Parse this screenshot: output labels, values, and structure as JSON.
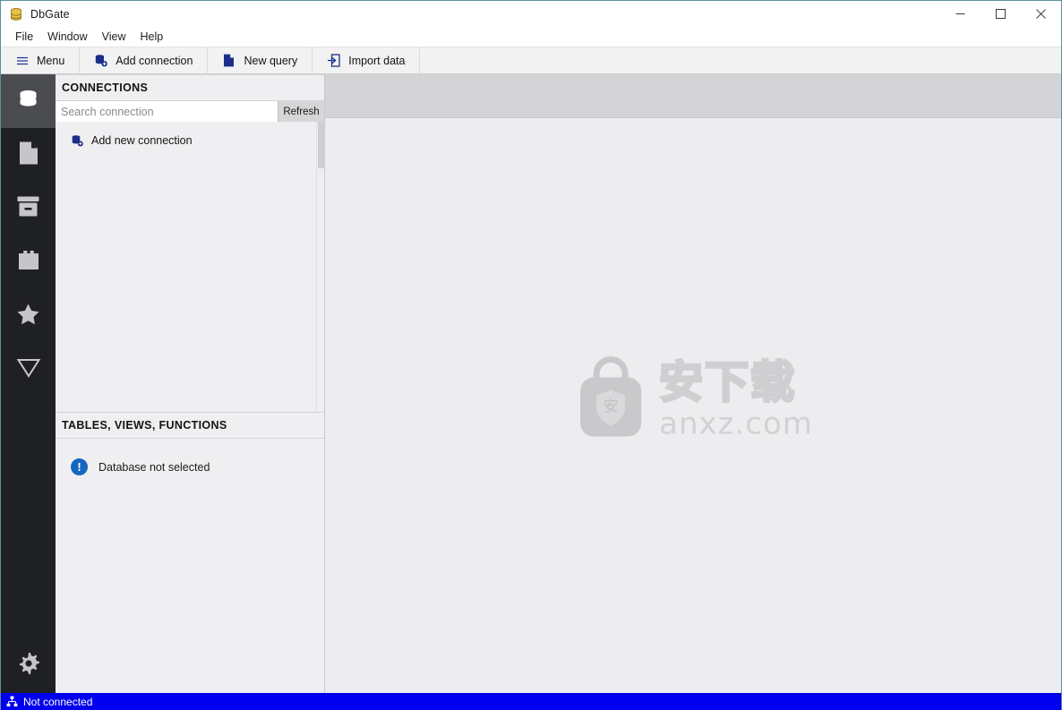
{
  "window": {
    "title": "DbGate",
    "app_icon": "database-icon",
    "controls": [
      {
        "name": "minimize-button",
        "glyph": "─"
      },
      {
        "name": "maximize-button",
        "glyph": "□"
      },
      {
        "name": "close-button",
        "glyph": "✕"
      }
    ]
  },
  "menubar": {
    "items": [
      {
        "label": "File"
      },
      {
        "label": "Window"
      },
      {
        "label": "View"
      },
      {
        "label": "Help"
      }
    ]
  },
  "toolbar": {
    "buttons": [
      {
        "label": "Menu",
        "icon": "hamburger-icon"
      },
      {
        "label": "Add connection",
        "icon": "database-plus-icon"
      },
      {
        "label": "New query",
        "icon": "file-icon"
      },
      {
        "label": "Import data",
        "icon": "import-arrow-icon"
      }
    ]
  },
  "rail": {
    "items": [
      {
        "name": "sidebar-item-connections",
        "icon": "database-icon",
        "active": true
      },
      {
        "name": "sidebar-item-files",
        "icon": "file-icon",
        "active": false
      },
      {
        "name": "sidebar-item-archive",
        "icon": "archive-icon",
        "active": false
      },
      {
        "name": "sidebar-item-plugins",
        "icon": "plugin-icon",
        "active": false
      },
      {
        "name": "sidebar-item-favorites",
        "icon": "star-icon",
        "active": false
      },
      {
        "name": "sidebar-item-filter",
        "icon": "funnel-icon",
        "active": false
      }
    ],
    "bottom": {
      "name": "sidebar-item-settings",
      "icon": "gear-icon"
    }
  },
  "connections_panel": {
    "header": "CONNECTIONS",
    "search": {
      "placeholder": "Search connection",
      "value": ""
    },
    "refresh_label": "Refresh",
    "items": [
      {
        "label": "Add new connection",
        "icon": "database-plus-icon"
      }
    ]
  },
  "objects_panel": {
    "header": "TABLES, VIEWS, FUNCTIONS",
    "notice": {
      "icon": "info-exclamation-icon",
      "text": "Database not selected",
      "color": "#1566c0"
    }
  },
  "main": {
    "tabs": [],
    "watermark": {
      "logo": "shield-bag-logo",
      "chinese": "安下载",
      "domain": "anxz.com"
    }
  },
  "statusbar": {
    "icon": "network-icon",
    "text": "Not connected",
    "background": "#0000ee"
  },
  "colors": {
    "rail_bg": "#1f2024",
    "rail_active": "#4b4c50",
    "panel_bg": "#efeff1",
    "main_bg": "#ededef",
    "tabstrip_bg": "#d4d3d5",
    "accent_blue": "#1b2f8a",
    "status_blue": "#0000ee",
    "window_border": "#5c8fa0"
  }
}
